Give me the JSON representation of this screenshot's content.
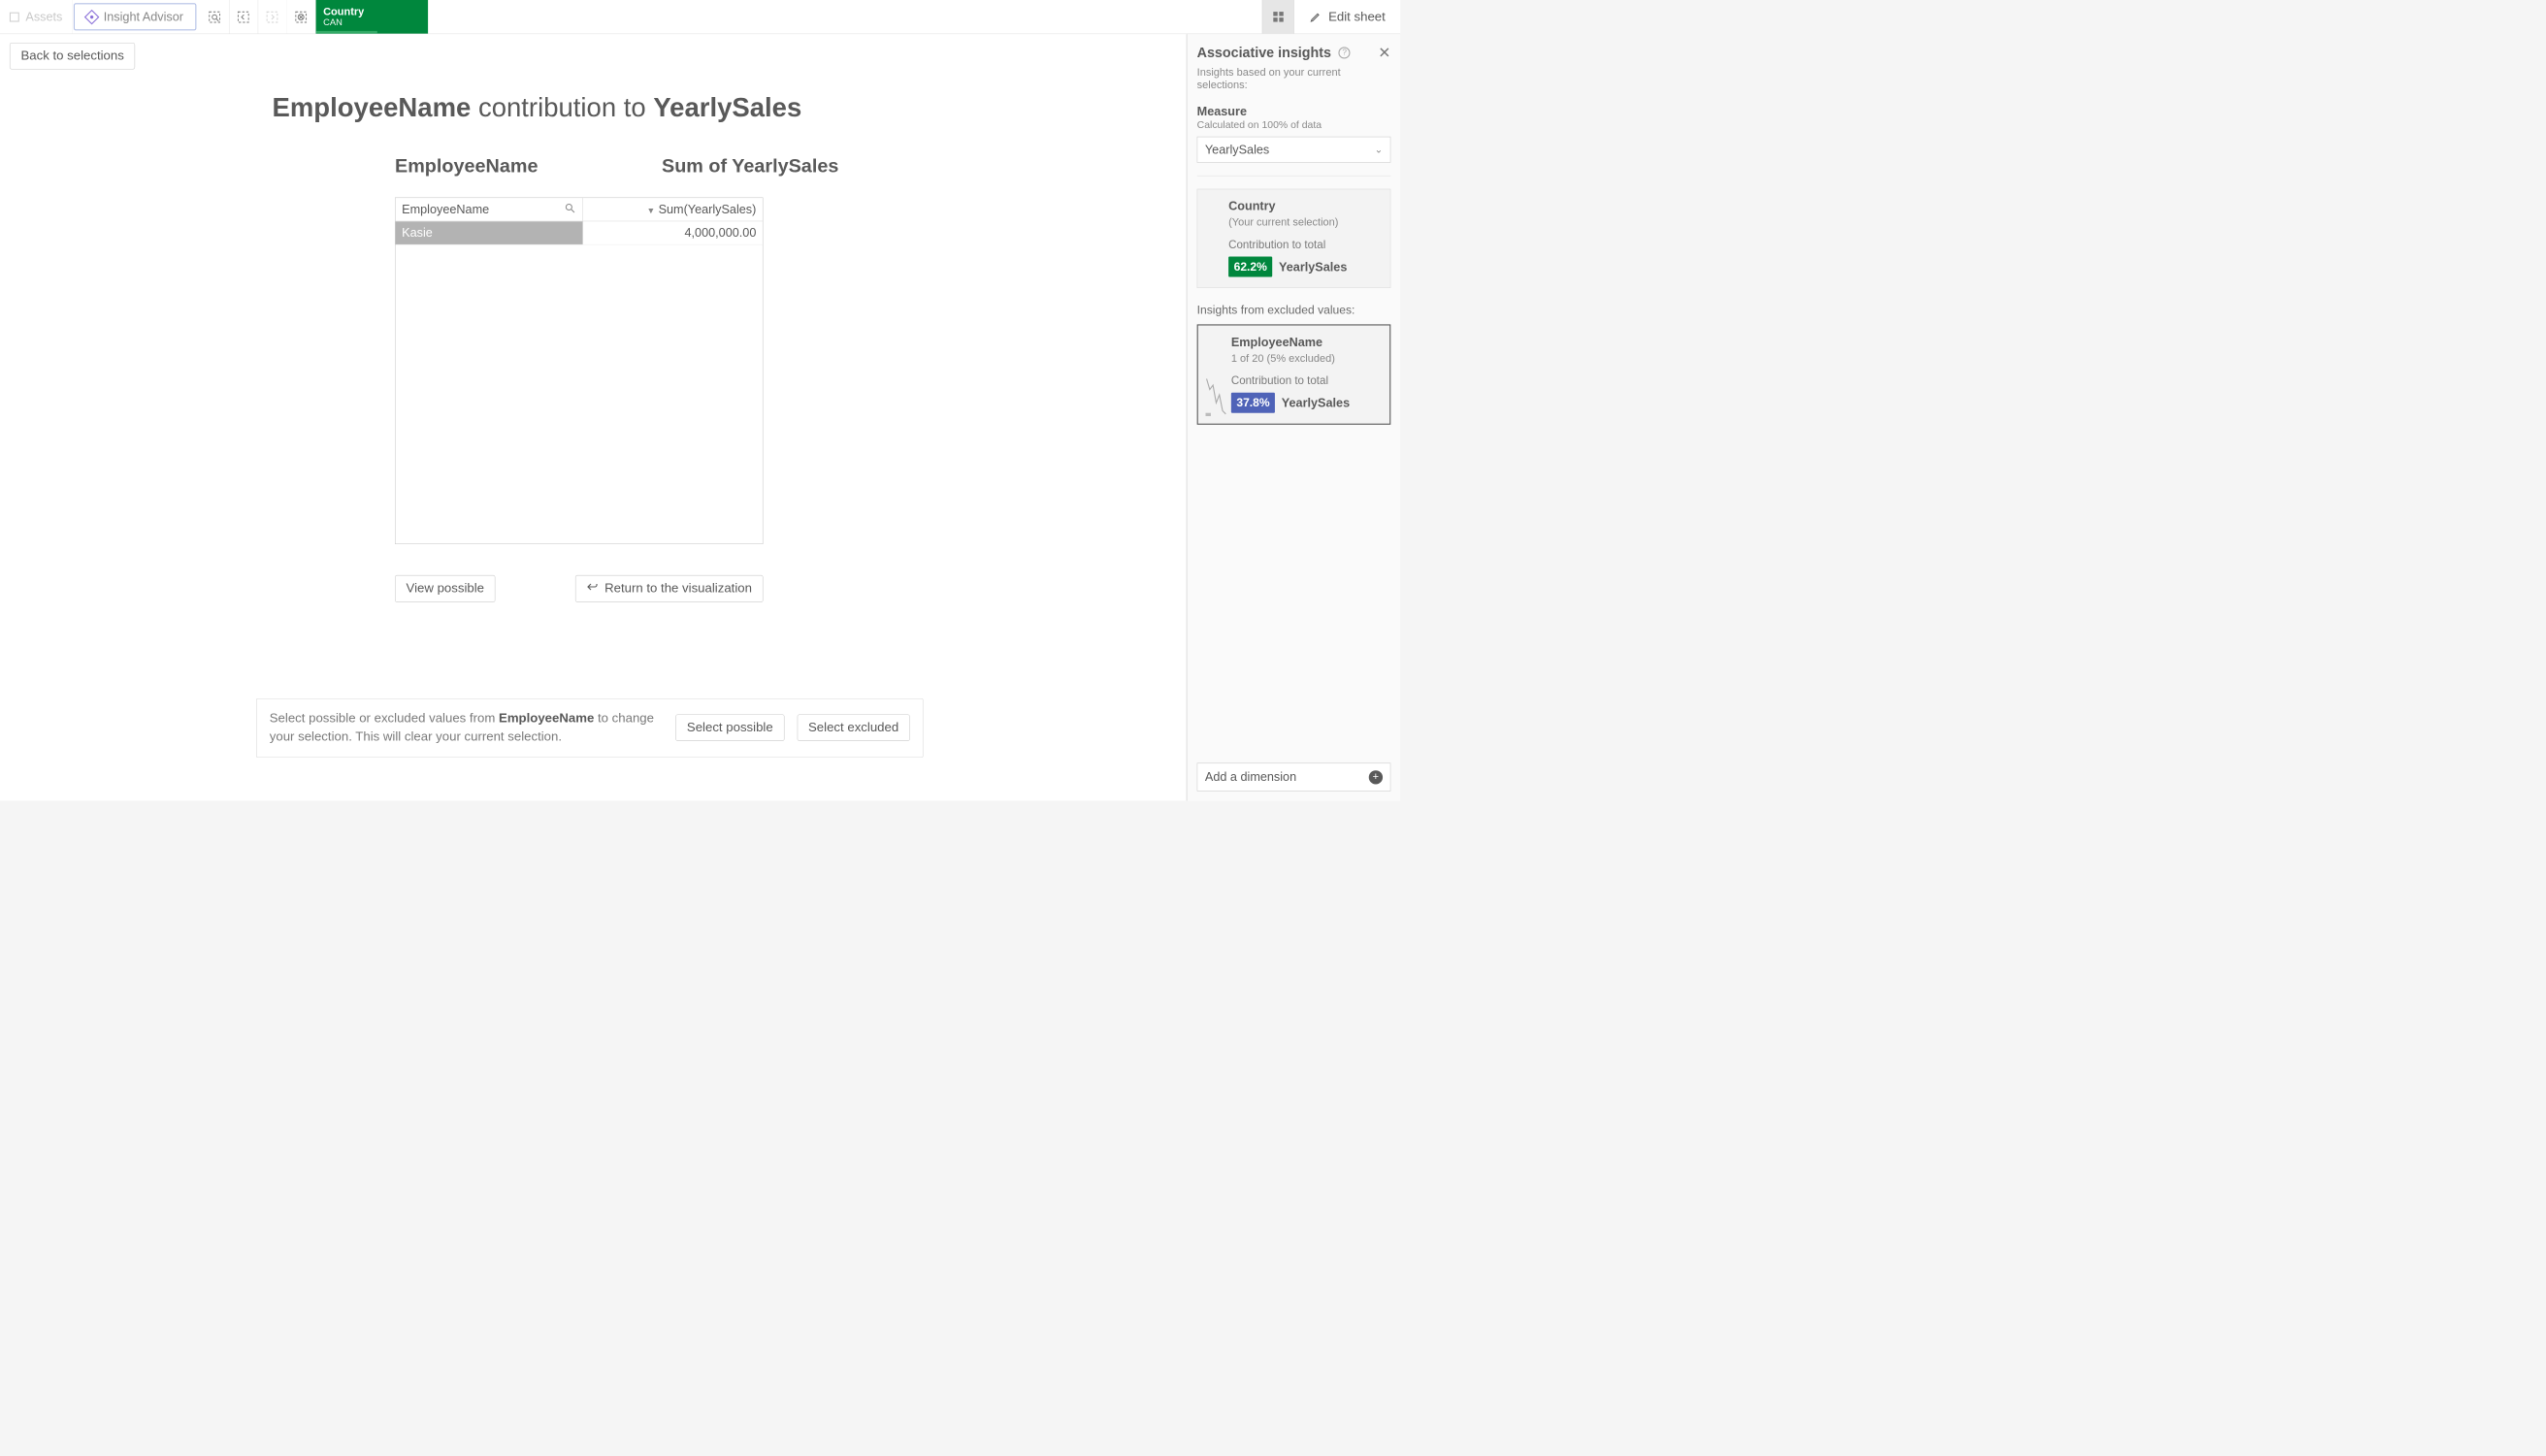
{
  "toolbar": {
    "assets_label": "Assets",
    "insight_advisor_label": "Insight Advisor",
    "selection_tag": {
      "field": "Country",
      "value": "CAN"
    },
    "edit_sheet_label": "Edit sheet"
  },
  "main": {
    "back_label": "Back to selections",
    "title": {
      "dimension": "EmployeeName",
      "middle": " contribution to ",
      "measure": "YearlySales"
    },
    "col_headers": {
      "dimension": "EmployeeName",
      "sum": "Sum of YearlySales"
    },
    "table": {
      "columns": [
        {
          "label": "EmployeeName",
          "key": "name"
        },
        {
          "label": "Sum(YearlySales)",
          "key": "sum",
          "sorted_desc": true
        }
      ],
      "rows": [
        {
          "name": "Kasie",
          "sum": "4,000,000.00"
        }
      ]
    },
    "buttons": {
      "view_possible": "View possible",
      "return_viz": "Return to the visualization"
    },
    "footer": {
      "pre": "Select possible or excluded values from ",
      "dim": "EmployeeName",
      "post": " to change your selection. This will clear your current selection.",
      "select_possible": "Select possible",
      "select_excluded": "Select excluded"
    }
  },
  "panel": {
    "title": "Associative insights",
    "subtitle": "Insights based on your current selections:",
    "measure_label": "Measure",
    "measure_hint": "Calculated on 100% of data",
    "measure_value": "YearlySales",
    "card_selection": {
      "title": "Country",
      "sub": "(Your current selection)",
      "contrib_label": "Contribution to total",
      "pct": "62.2%",
      "measure": "YearlySales"
    },
    "excluded_section_title": "Insights from excluded values:",
    "card_excluded": {
      "title": "EmployeeName",
      "sub": "1 of 20 (5% excluded)",
      "contrib_label": "Contribution to total",
      "pct": "37.8%",
      "measure": "YearlySales"
    },
    "add_dimension_label": "Add a dimension"
  }
}
